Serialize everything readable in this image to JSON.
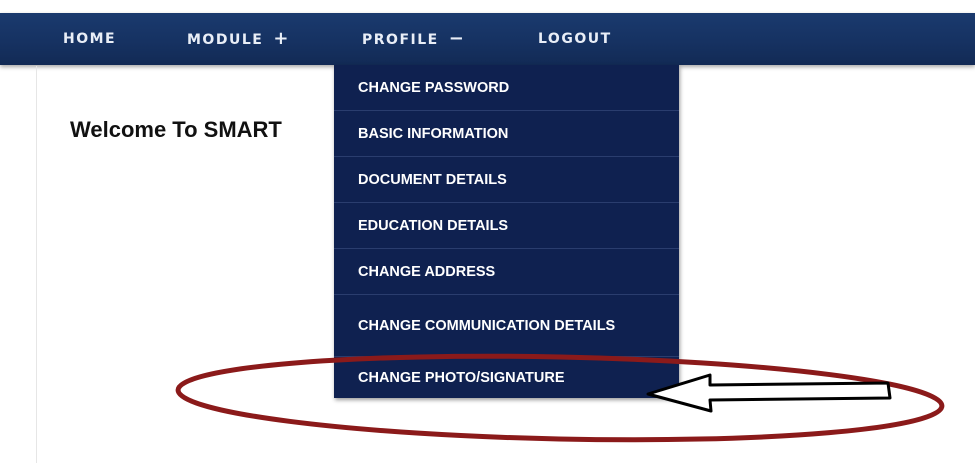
{
  "nav": {
    "home": "HOME",
    "module": "MODULE",
    "module_toggle": "+",
    "profile": "PROFILE",
    "profile_toggle": "−",
    "logout": "LOGOUT"
  },
  "main": {
    "welcome_text": "Welcome To SMART"
  },
  "profile_menu": {
    "items": [
      "CHANGE PASSWORD",
      "BASIC INFORMATION",
      "DOCUMENT DETAILS",
      "EDUCATION DETAILS",
      "CHANGE ADDRESS",
      "CHANGE COMMUNICATION DETAILS",
      "CHANGE PHOTO/SIGNATURE"
    ]
  },
  "colors": {
    "navbar": "#163262",
    "dropdown": "#0f2150",
    "annotation_ellipse": "#8b1a1a"
  }
}
